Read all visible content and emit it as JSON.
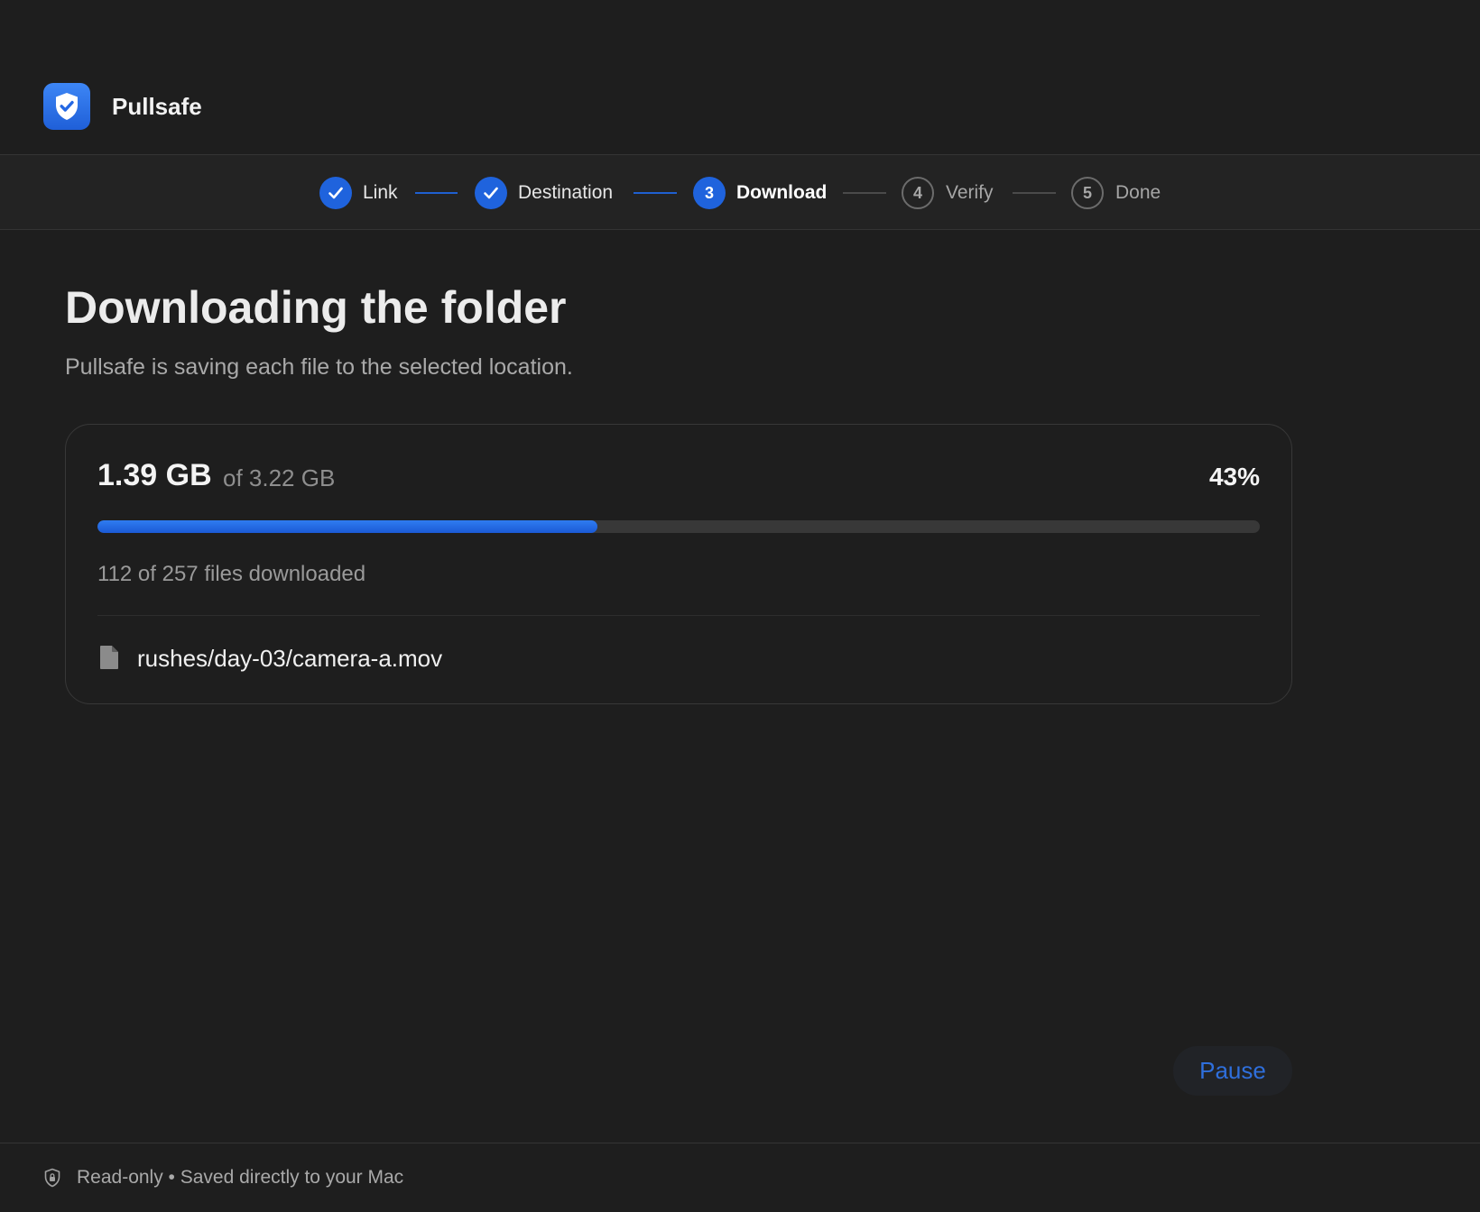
{
  "app": {
    "name": "Pullsafe",
    "icon": "shield-check-icon",
    "accent_color": "#1f63dd"
  },
  "stepper": {
    "steps": [
      {
        "number": "1",
        "label": "Link",
        "state": "done"
      },
      {
        "number": "2",
        "label": "Destination",
        "state": "done"
      },
      {
        "number": "3",
        "label": "Download",
        "state": "active"
      },
      {
        "number": "4",
        "label": "Verify",
        "state": "pending"
      },
      {
        "number": "5",
        "label": "Done",
        "state": "pending"
      }
    ]
  },
  "main": {
    "title": "Downloading the folder",
    "subtitle": "Pullsafe is saving each file to the selected location."
  },
  "progress": {
    "downloaded": "1.39 GB",
    "total": "of 3.22 GB",
    "percent_label": "43%",
    "fraction": 0.43,
    "files_status": "112 of 257 files downloaded",
    "current_file": "rushes/day-03/camera-a.mov",
    "current_file_icon": "document-icon"
  },
  "actions": {
    "pause_label": "Pause"
  },
  "footer": {
    "icon": "lock-shield-icon",
    "text": "Read-only • Saved directly to your Mac"
  }
}
